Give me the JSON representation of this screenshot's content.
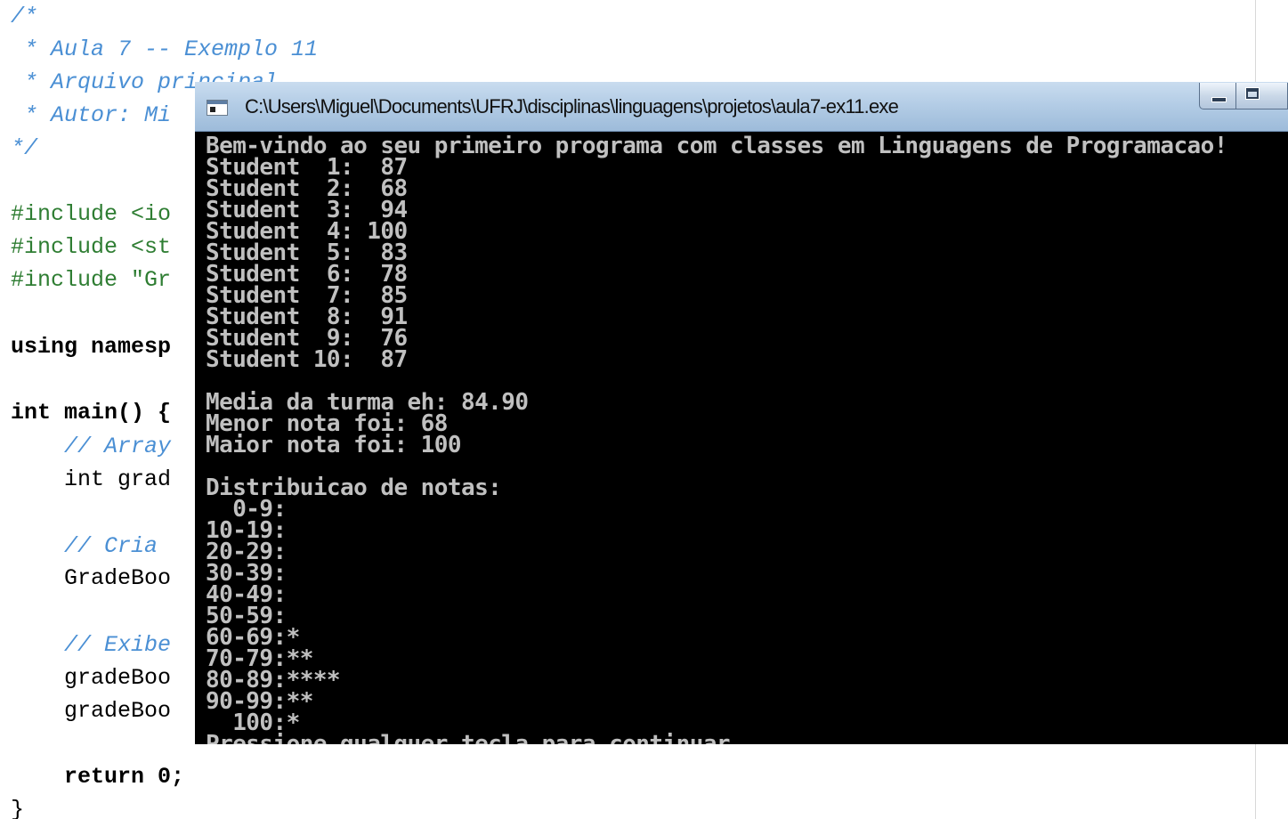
{
  "editor": {
    "lines": [
      "/*",
      " * Aula 7 -- Exemplo 11",
      " * Arquivo principal",
      " * Autor: Mi",
      "*/",
      "",
      "#include <io",
      "#include <st",
      "#include \"Gr",
      "",
      "using namesp",
      "",
      "int main() {",
      "    // Array",
      "    int grad",
      "",
      "    // Cria",
      "    GradeBoo",
      "",
      "    // Exibe",
      "    gradeBoo",
      "    gradeBoo",
      "",
      "    return 0;",
      "}"
    ]
  },
  "console": {
    "title": "C:\\Users\\Miguel\\Documents\\UFRJ\\disciplinas\\linguagens\\projetos\\aula7-ex11.exe",
    "output": [
      "Bem-vindo ao seu primeiro programa com classes em Linguagens de Programacao!",
      "Student  1:  87",
      "Student  2:  68",
      "Student  3:  94",
      "Student  4: 100",
      "Student  5:  83",
      "Student  6:  78",
      "Student  7:  85",
      "Student  8:  91",
      "Student  9:  76",
      "Student 10:  87",
      "",
      "Media da turma eh: 84.90",
      "Menor nota foi: 68",
      "Maior nota foi: 100",
      "",
      "Distribuicao de notas:",
      "  0-9:",
      "10-19:",
      "20-29:",
      "30-39:",
      "40-49:",
      "50-59:",
      "60-69:*",
      "70-79:**",
      "80-89:****",
      "90-99:**",
      "  100:*",
      "Pressione qualquer tecla para continuar. . ."
    ]
  }
}
